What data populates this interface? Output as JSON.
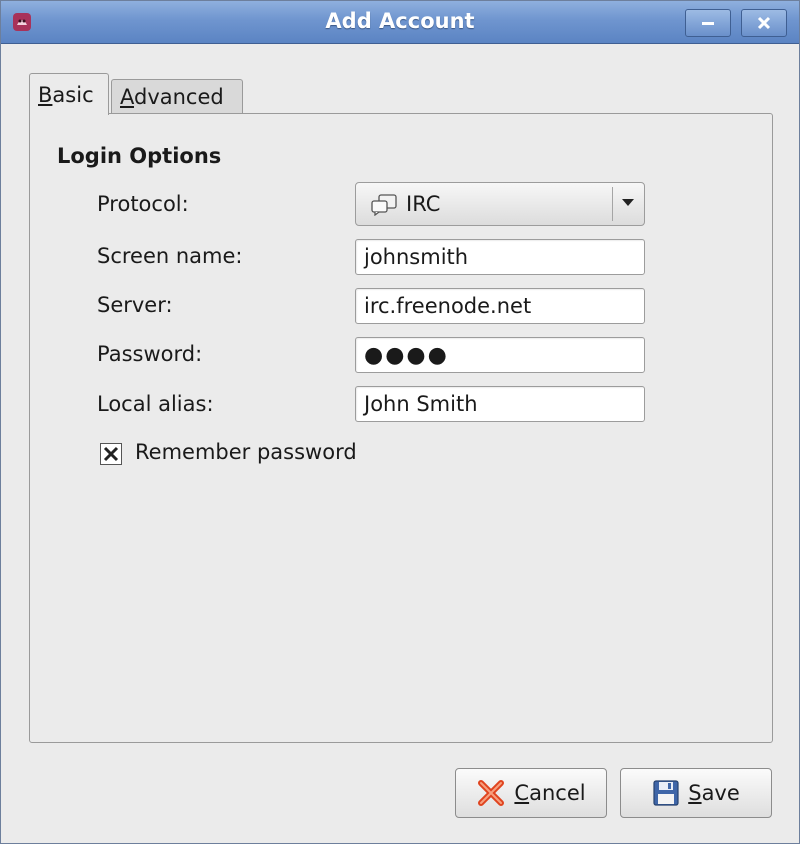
{
  "window": {
    "title": "Add Account"
  },
  "tabs": [
    {
      "label": "Basic",
      "mnemonic": "B",
      "rest": "asic",
      "selected": true
    },
    {
      "label": "Advanced",
      "mnemonic": "A",
      "rest": "dvanced",
      "selected": false
    }
  ],
  "login": {
    "section_title": "Login Options",
    "protocol_label": "Protocol:",
    "protocol_value": "IRC",
    "screen_name_label": "Screen name:",
    "screen_name_value": "johnsmith",
    "server_label": "Server:",
    "server_value": "irc.freenode.net",
    "password_label": "Password:",
    "password_mask": "●●●●",
    "alias_label": "Local alias:",
    "alias_value": "John Smith",
    "remember_label": "Remember password",
    "remember_checked": true
  },
  "buttons": {
    "cancel_label": "Cancel",
    "cancel_mnemonic": "C",
    "cancel_rest": "ancel",
    "save_label": "Save",
    "save_mnemonic": "S",
    "save_rest": "ave"
  },
  "icons": {
    "app": "pidgin-icon",
    "protocol": "irc-chat-icon",
    "cancel": "red-x-icon",
    "save": "floppy-disk-icon",
    "minimize": "minimize-icon",
    "close": "close-icon"
  },
  "colors": {
    "titlebar": "#6f95cf",
    "cancel_icon": "#e0441f",
    "save_icon": "#3f66a8"
  }
}
